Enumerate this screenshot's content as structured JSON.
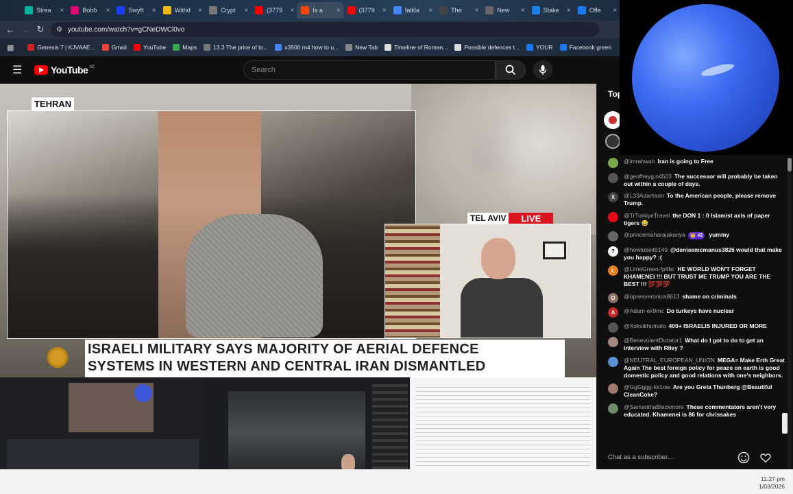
{
  "browser": {
    "tabs": [
      {
        "label": "Strea",
        "color": "#00b4a0"
      },
      {
        "label": "Bobb",
        "color": "#e60073"
      },
      {
        "label": "Swyft",
        "color": "#1a3cff"
      },
      {
        "label": "Withd",
        "color": "#f0b90b"
      },
      {
        "label": "Crypt",
        "color": "#777777"
      },
      {
        "label": "(3779",
        "color": "#ff0000"
      },
      {
        "label": "Is a",
        "color": "#ff4500"
      },
      {
        "label": "(3779",
        "color": "#ff0000"
      },
      {
        "label": "falkla",
        "color": "#4285f4"
      },
      {
        "label": "The",
        "color": "#444444"
      },
      {
        "label": "New",
        "color": "#666666"
      },
      {
        "label": "Stake",
        "color": "#1b7fe6"
      },
      {
        "label": "Offe",
        "color": "#1877f2"
      }
    ],
    "url": "youtube.com/watch?v=gCNeDWCl0vo",
    "bookmarks": [
      {
        "label": "Genesis 7 | KJVAAE...",
        "color": "#cc2222"
      },
      {
        "label": "Gmail",
        "color": "#ea4335"
      },
      {
        "label": "YouTube",
        "color": "#ff0000"
      },
      {
        "label": "Maps",
        "color": "#34a853"
      },
      {
        "label": "13.3 The price of to...",
        "color": "#777777"
      },
      {
        "label": "x3500 m4 how to u...",
        "color": "#4285f4"
      },
      {
        "label": "New Tab",
        "color": "#888888"
      },
      {
        "label": "Timeline of Roman...",
        "color": "#dddddd"
      },
      {
        "label": "Possible defences t...",
        "color": "#dddddd"
      },
      {
        "label": "YOUR",
        "color": "#1877f2"
      },
      {
        "label": "Facebook green",
        "color": "#1877f2"
      }
    ]
  },
  "youtube": {
    "logo_text": "YouTube",
    "region": "NZ",
    "search_placeholder": "Search"
  },
  "video": {
    "location_label": "TEHRAN",
    "pip_city": "TEL AVIV",
    "live_label": "LIVE",
    "headline_line1": "ISRAELI MILITARY SAYS MAJORITY OF AERIAL DEFENCE",
    "headline_line2": "SYSTEMS IN WESTERN AND CENTRAL IRAN DISMANTLED"
  },
  "chat": {
    "header": "Top",
    "input_placeholder": "Chat as a subscriber...",
    "messages": [
      {
        "author": "@imrahwah",
        "text": "Iran is going to Free",
        "avatar_color": "#7aa84a",
        "initial": ""
      },
      {
        "author": "@geoffreyg.n4503",
        "text": "The successor will probably be taken out within a couple of days.",
        "avatar_color": "#555555",
        "initial": ""
      },
      {
        "author": "@L33Adamson",
        "text": "To the American people, please remove Trump.",
        "avatar_color": "#444444",
        "initial": "X"
      },
      {
        "author": "@TrTurkiyeTravel",
        "text": "the DON 1 : 0 Islamist axis of paper tigers 😂",
        "avatar_color": "#e30a17",
        "initial": ""
      },
      {
        "author": "@princemaharajakanya",
        "badge": "👑 #2",
        "text": "yummy",
        "avatar_color": "#666666",
        "initial": ""
      },
      {
        "author": "@howtobeit9149",
        "text": "@denisemcmanus3826 would that make you happy? :(",
        "avatar_color": "#ffffff",
        "initial": "?"
      },
      {
        "author": "@LimeGreen-fp4bc",
        "text": "HE WORLD WON'T FORGET KHAMENEI !!! BUT TRUST ME TRUMP YOU ARE THE BEST !!! 💯💯💯",
        "avatar_color": "#e67e22",
        "initial": "L"
      },
      {
        "author": "@opreaveronica8613",
        "text": "shame on criminals",
        "avatar_color": "#8d6e63",
        "initial": "O"
      },
      {
        "author": "@Adam-ex9mc",
        "text": "Do turkeys have nuclear",
        "avatar_color": "#c62828",
        "initial": "A"
      },
      {
        "author": "@Xoksikhumalo",
        "text": "400+ ISRAELIS INJURED OR MORE",
        "avatar_color": "#555555",
        "initial": ""
      },
      {
        "author": "@BenevolentDictator1",
        "text": "What do I got to do to get an interview with Riley ?",
        "avatar_color": "#a1887f",
        "initial": ""
      },
      {
        "author": "@NEUTRAL_EUROPEAN_UNION",
        "text": "MEGA= Make Erth Great Again The best foreign policy for peace on earth is good domestic policy and good relations with one's neighbors.",
        "avatar_color": "#5c8fd6",
        "initial": ""
      },
      {
        "author": "@GgGggg-kk1ow",
        "text": "Are you Greta Thunberg @Beautiful CleanCoke?",
        "avatar_color": "#9e7b6a",
        "initial": ""
      },
      {
        "author": "@SamanthaBlackmore",
        "text": "These commentators aren't very educated. Khamenei is 86 for chrissakes",
        "avatar_color": "#6d8a6d",
        "initial": ""
      }
    ]
  },
  "taskbar": {
    "time": "11:27 pm",
    "date": "1/03/2026"
  },
  "colors": {
    "youtube_red": "#ff0000",
    "live_red": "#d9141e",
    "neptune_blue": "#3f6ef2"
  }
}
